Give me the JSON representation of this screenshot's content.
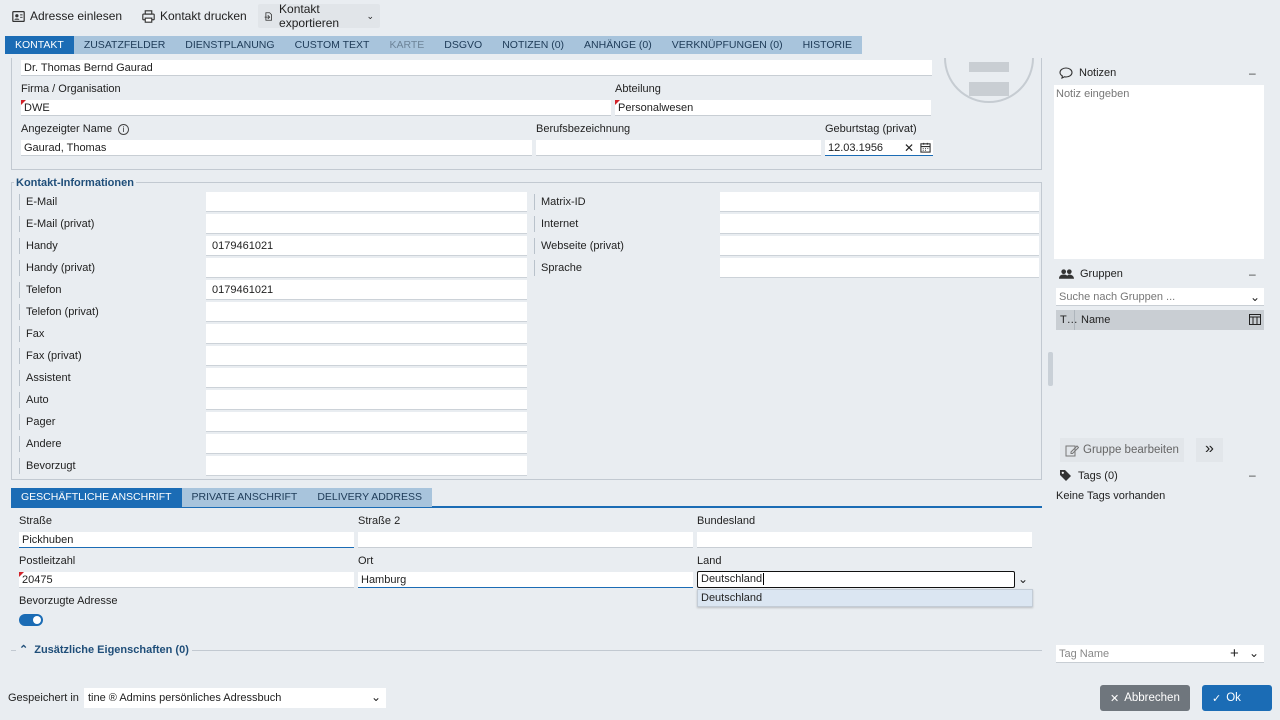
{
  "toolbar": {
    "read_address": "Adresse einlesen",
    "print_contact": "Kontakt drucken",
    "export_contact": "Kontakt exportieren"
  },
  "tabs": [
    {
      "label": "KONTAKT",
      "state": "active"
    },
    {
      "label": "ZUSATZFELDER",
      "state": "normal"
    },
    {
      "label": "DIENSTPLANUNG",
      "state": "normal"
    },
    {
      "label": "CUSTOM TEXT",
      "state": "normal"
    },
    {
      "label": "KARTE",
      "state": "disabled"
    },
    {
      "label": "DSGVO",
      "state": "normal"
    },
    {
      "label": "NOTIZEN (0)",
      "state": "normal"
    },
    {
      "label": "ANHÄNGE (0)",
      "state": "normal"
    },
    {
      "label": "VERKNÜPFUNGEN (0)",
      "state": "normal"
    },
    {
      "label": "HISTORIE",
      "state": "normal"
    }
  ],
  "contact": {
    "full_name": "Dr. Thomas Bernd Gaurad",
    "company_label": "Firma / Organisation",
    "company": "DWE",
    "department_label": "Abteilung",
    "department": "Personalwesen",
    "display_name_label": "Angezeigter Name",
    "display_name": "Gaurad, Thomas",
    "job_title_label": "Berufsbezeichnung",
    "job_title": "",
    "birthday_label": "Geburtstag (privat)",
    "birthday": "12.03.1956"
  },
  "contact_info": {
    "legend": "Kontakt-Informationen",
    "left": [
      {
        "label": "E-Mail",
        "value": ""
      },
      {
        "label": "E-Mail (privat)",
        "value": ""
      },
      {
        "label": "Handy",
        "value": "0179461021"
      },
      {
        "label": "Handy (privat)",
        "value": ""
      },
      {
        "label": "Telefon",
        "value": "0179461021"
      },
      {
        "label": "Telefon (privat)",
        "value": ""
      },
      {
        "label": "Fax",
        "value": ""
      },
      {
        "label": "Fax (privat)",
        "value": ""
      },
      {
        "label": "Assistent",
        "value": ""
      },
      {
        "label": "Auto",
        "value": ""
      },
      {
        "label": "Pager",
        "value": ""
      },
      {
        "label": "Andere",
        "value": ""
      },
      {
        "label": "Bevorzugt",
        "value": ""
      }
    ],
    "right": [
      {
        "label": "Matrix-ID",
        "value": ""
      },
      {
        "label": "Internet",
        "value": ""
      },
      {
        "label": "Webseite (privat)",
        "value": ""
      },
      {
        "label": "Sprache",
        "value": ""
      }
    ]
  },
  "address_tabs": [
    {
      "label": "GESCHÄFTLICHE ANSCHRIFT",
      "state": "active"
    },
    {
      "label": "PRIVATE ANSCHRIFT",
      "state": "normal"
    },
    {
      "label": "DELIVERY ADDRESS",
      "state": "normal"
    }
  ],
  "address": {
    "street_label": "Straße",
    "street": "Pickhuben",
    "street2_label": "Straße 2",
    "street2": "",
    "state_label": "Bundesland",
    "state": "",
    "zip_label": "Postleitzahl",
    "zip": "20475",
    "city_label": "Ort",
    "city": "Hamburg",
    "country_label": "Land",
    "country": "Deutschland",
    "country_option": "Deutschland",
    "preferred_label": "Bevorzugte Adresse",
    "preferred": true
  },
  "extra_props": "Zusätzliche Eigenschaften (0)",
  "notes": {
    "title": "Notizen",
    "placeholder": "Notiz eingeben"
  },
  "groups": {
    "title": "Gruppen",
    "search_placeholder": "Suche nach Gruppen ...",
    "col_type": "T…",
    "col_name": "Name",
    "edit_button": "Gruppe bearbeiten"
  },
  "tags": {
    "title": "Tags (0)",
    "empty": "Keine Tags vorhanden",
    "input_placeholder": "Tag Name"
  },
  "footer": {
    "saved_in_label": "Gespeichert in",
    "saved_in": "tine ® Admins persönliches Adressbuch",
    "cancel": "Abbrechen",
    "ok": "Ok"
  },
  "colors": {
    "accent": "#1b6cb5",
    "tab_bg": "#a8c4dc",
    "page_bg": "#e9edf1",
    "required": "#d1232a",
    "cancel_bg": "#6f767d"
  }
}
